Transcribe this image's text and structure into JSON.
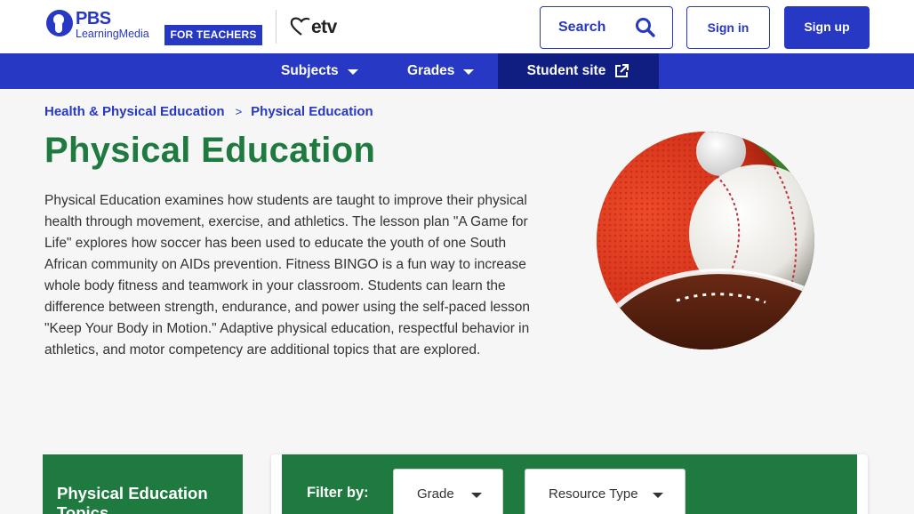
{
  "header": {
    "logo_brand": "PBS",
    "logo_sub": "LearningMedia",
    "badge": "FOR TEACHERS",
    "partner_logo": "etv",
    "search_label": "Search",
    "signin_label": "Sign in",
    "signup_label": "Sign up",
    "icons": {
      "search": "search-icon",
      "logo": "pbs-head-icon",
      "partner": "etv-heart-icon"
    }
  },
  "nav": {
    "items": [
      {
        "label": "Subjects",
        "icon": "caret-down-icon"
      },
      {
        "label": "Grades",
        "icon": "caret-down-icon"
      },
      {
        "label": "Student site",
        "icon": "external-link-icon"
      }
    ]
  },
  "breadcrumb": {
    "items": [
      "Health & Physical Education",
      "Physical Education"
    ],
    "separator": ">"
  },
  "page": {
    "title": "Physical Education",
    "description": "Physical Education examines how students are taught to improve their physical health through movement, exercise, and athletics. The lesson plan \"A Game for Life\" explores how soccer has been used to educate the youth of one South African community on AIDs prevention. Fitness BINGO is a fun way to increase whole body fitness and teamwork in your classroom. Students can learn the difference between strength, endurance, and power using the self-paced lesson \"Keep Your Body in Motion.\" Adaptive physical education, respectful behavior in athletics, and motor competency are additional topics that are explored."
  },
  "topics": {
    "title": "Physical Education Topics"
  },
  "filter": {
    "label": "Filter by:",
    "selects": [
      "Grade",
      "Resource Type"
    ]
  },
  "colors": {
    "brand_blue": "#2638c4",
    "nav_active": "#0f1e80",
    "title_green": "#1e7a3e"
  }
}
